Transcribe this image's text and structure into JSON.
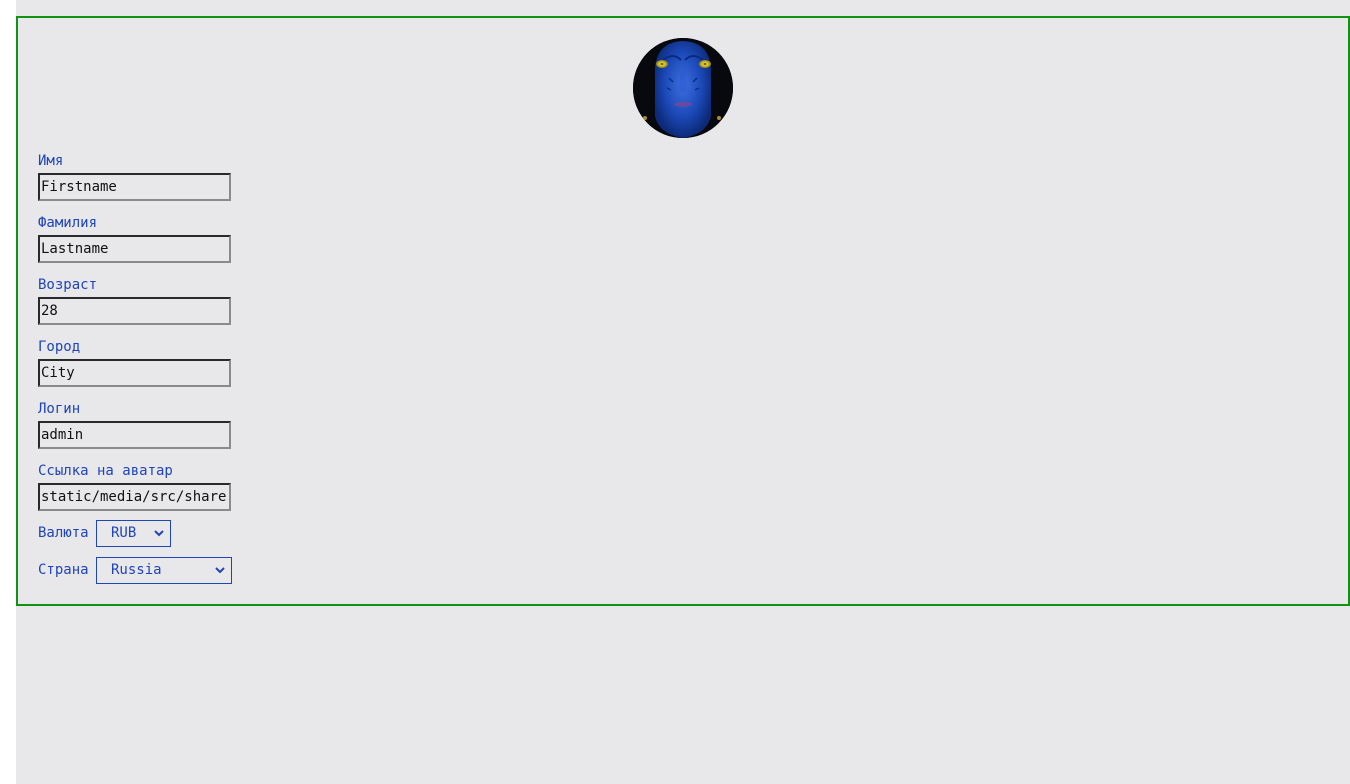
{
  "profile": {
    "avatar_alt": "Avatar",
    "fields": [
      {
        "key": "firstname",
        "label": "Имя",
        "value": "Firstname"
      },
      {
        "key": "lastname",
        "label": "Фамилия",
        "value": "Lastname"
      },
      {
        "key": "age",
        "label": "Возраст",
        "value": "28"
      },
      {
        "key": "city",
        "label": "Город",
        "value": "City"
      },
      {
        "key": "username",
        "label": "Логин",
        "value": "admin"
      },
      {
        "key": "avatar",
        "label": "Ссылка на аватар",
        "value": "static/media/src/share"
      }
    ],
    "currency": {
      "label": "Валюта",
      "value": "RUB"
    },
    "country": {
      "label": "Страна",
      "value": "Russia"
    }
  },
  "colors": {
    "accent": "#1f44b8",
    "card_border": "#129212",
    "background": "#e8e8ea"
  },
  "icons": {
    "select_chevron": "chevron-down-icon"
  }
}
